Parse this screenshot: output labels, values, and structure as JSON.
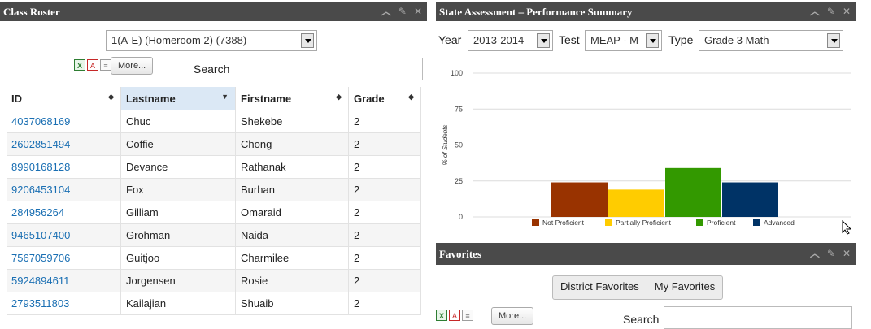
{
  "roster": {
    "title": "Class Roster",
    "class_select": "1(A-E) (Homeroom 2) (7388)",
    "more_label": "More...",
    "search_label": "Search",
    "columns": [
      "ID",
      "Lastname",
      "Firstname",
      "Grade"
    ],
    "rows": [
      {
        "id": "4037068169",
        "last": "Chuc",
        "first": "Shekebe",
        "grade": "2"
      },
      {
        "id": "2602851494",
        "last": "Coffie",
        "first": "Chong",
        "grade": "2"
      },
      {
        "id": "8990168128",
        "last": "Devance",
        "first": "Rathanak",
        "grade": "2"
      },
      {
        "id": "9206453104",
        "last": "Fox",
        "first": "Burhan",
        "grade": "2"
      },
      {
        "id": "284956264",
        "last": "Gilliam",
        "first": "Omaraid",
        "grade": "2"
      },
      {
        "id": "9465107400",
        "last": "Grohman",
        "first": "Naida",
        "grade": "2"
      },
      {
        "id": "7567059706",
        "last": "Guitjoo",
        "first": "Charmilee",
        "grade": "2"
      },
      {
        "id": "5924894611",
        "last": "Jorgensen",
        "first": "Rosie",
        "grade": "2"
      },
      {
        "id": "2793511803",
        "last": "Kailajian",
        "first": "Shuaib",
        "grade": "2"
      }
    ]
  },
  "assessment": {
    "title": "State Assessment – Performance Summary",
    "year_label": "Year",
    "year_value": "2013-2014",
    "test_label": "Test",
    "test_value": "MEAP - M",
    "type_label": "Type",
    "type_value": "Grade 3 Math"
  },
  "favorites": {
    "title": "Favorites",
    "tab_district": "District Favorites",
    "tab_my": "My Favorites",
    "more_label": "More...",
    "search_label": "Search"
  },
  "colors": {
    "not_proficient": "#993300",
    "partially": "#ffcc00",
    "proficient": "#339900",
    "advanced": "#003366"
  },
  "chart_data": {
    "type": "bar",
    "ylabel": "% of Students",
    "ylim": [
      0,
      100
    ],
    "yticks": [
      0,
      25,
      50,
      75,
      100
    ],
    "grid": true,
    "legend_position": "bottom",
    "series": [
      {
        "name": "Not Proficient",
        "value": 24,
        "color": "#993300"
      },
      {
        "name": "Partially Proficient",
        "value": 19,
        "color": "#ffcc00"
      },
      {
        "name": "Proficient",
        "value": 34,
        "color": "#339900"
      },
      {
        "name": "Advanced",
        "value": 24,
        "color": "#003366"
      }
    ]
  }
}
